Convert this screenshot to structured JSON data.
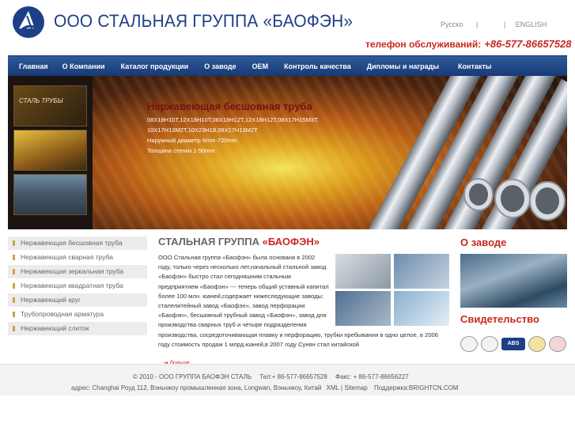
{
  "header": {
    "company_title": "ООО СТАЛЬНАЯ ГРУППА «БАОФЭН»",
    "lang_ru": "Русско",
    "lang_sep1": "|",
    "lang_sep2": "|",
    "lang_en": "ENGLISH",
    "phone_label": "телефон обслуживаний:",
    "phone_number": "+86-577-86657528"
  },
  "nav": {
    "items": [
      "Главная",
      "О Компании",
      "Каталог продукции",
      "О заводе",
      "OEM",
      "Контроль качества",
      "Дипломы и награды",
      "Контакты"
    ]
  },
  "banner": {
    "thumb1_text": "СТАЛЬ ТРУБЫ",
    "title": "Нержавеющая бесшовная труба",
    "lines": [
      "08Х18Н10Т,12Х18Н10Т,08Х18Н12Т,12Х18Н12Т,08Х17Н15М3Т,",
      "10Х17Н13М2Т,10Х23Н18,08Х17Н13М2Т",
      "Наружный диаметр 6mm-720mm",
      "Толщина стенки 1-50mm"
    ]
  },
  "sidebar": {
    "items": [
      "Нержавеющая бесшовная труба",
      "Нержавеющая сварная труба",
      "Нержавеющая зеркальная труба",
      "Нержавеющая квадратная труба",
      "Нержавеющий круг",
      "Трубопроводная арматура",
      "Нержавеющий слиток"
    ]
  },
  "center": {
    "title_prefix": "СТАЛЬНАЯ ГРУППА",
    "title_accent": "«БАОФЭН»",
    "intro_narrow": "ООО Стальная группа «Баофэн» была основана в 2002 году, только через несколько лет,начальный стальной завод «Баофэн» быстро стал сегодняшним стальным предприятием «Баофэн» --- теперь общий уставный капитал более 100 млн. юаней,содержает нижеследующие заводы: сталелитейный завод «Баофэн», завод перфорации «Баофэн», бесшовный трубный завод «Баофэн», завод для производства сварных труб и четыре подразделения",
    "intro_wide": "производства, сосредоточивающая плавку и перфорацию, трубки пребывания в одно целое, в 2006 году стоимость продаж 1 млрд.юаней,в 2007 году Сунян стал китайской",
    "more": "больше"
  },
  "right": {
    "factory_title": "О заводе",
    "cert_title": "Свидетельство",
    "cert_abs": "ABS"
  },
  "footer": {
    "copyright": "© 2010 - ООО ГРУППА БАОФЭН СТАЛЬ",
    "tel": "Тел:+ 86-577-86657528",
    "fax": "Факс: + 86-577-86656227",
    "address": "адрес: Changhai Роуд 112, Вэньчжоу промышленная зона, Longwan, Вэньчжоу, Китай",
    "xml": "XML",
    "sep": "|",
    "sitemap": "Sitemap",
    "support": "Поддержка:BRIGHTCN.COM"
  },
  "colors": {
    "brand_blue": "#1d3f86",
    "accent_red": "#c9281e",
    "nav_top": "#2f5a9c",
    "nav_bottom": "#173a75"
  }
}
